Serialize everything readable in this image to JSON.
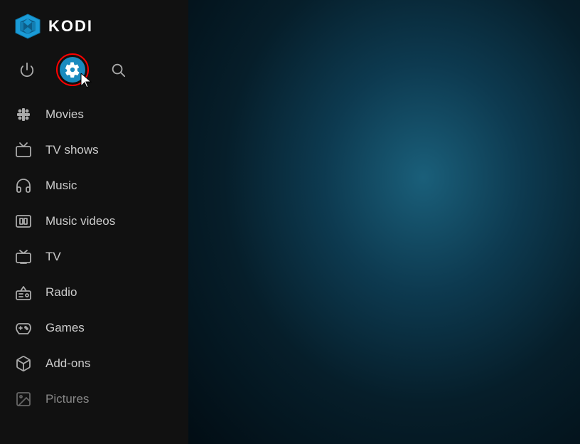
{
  "app": {
    "name": "KODI"
  },
  "top_icons": {
    "power_label": "Power",
    "settings_label": "Settings",
    "search_label": "Search"
  },
  "nav": {
    "items": [
      {
        "id": "movies",
        "label": "Movies",
        "icon": "movies"
      },
      {
        "id": "tv-shows",
        "label": "TV shows",
        "icon": "tv"
      },
      {
        "id": "music",
        "label": "Music",
        "icon": "music"
      },
      {
        "id": "music-videos",
        "label": "Music videos",
        "icon": "music-videos"
      },
      {
        "id": "tv",
        "label": "TV",
        "icon": "tv-live"
      },
      {
        "id": "radio",
        "label": "Radio",
        "icon": "radio"
      },
      {
        "id": "games",
        "label": "Games",
        "icon": "games"
      },
      {
        "id": "add-ons",
        "label": "Add-ons",
        "icon": "addons"
      },
      {
        "id": "pictures",
        "label": "Pictures",
        "icon": "pictures",
        "dimmed": true
      }
    ]
  }
}
